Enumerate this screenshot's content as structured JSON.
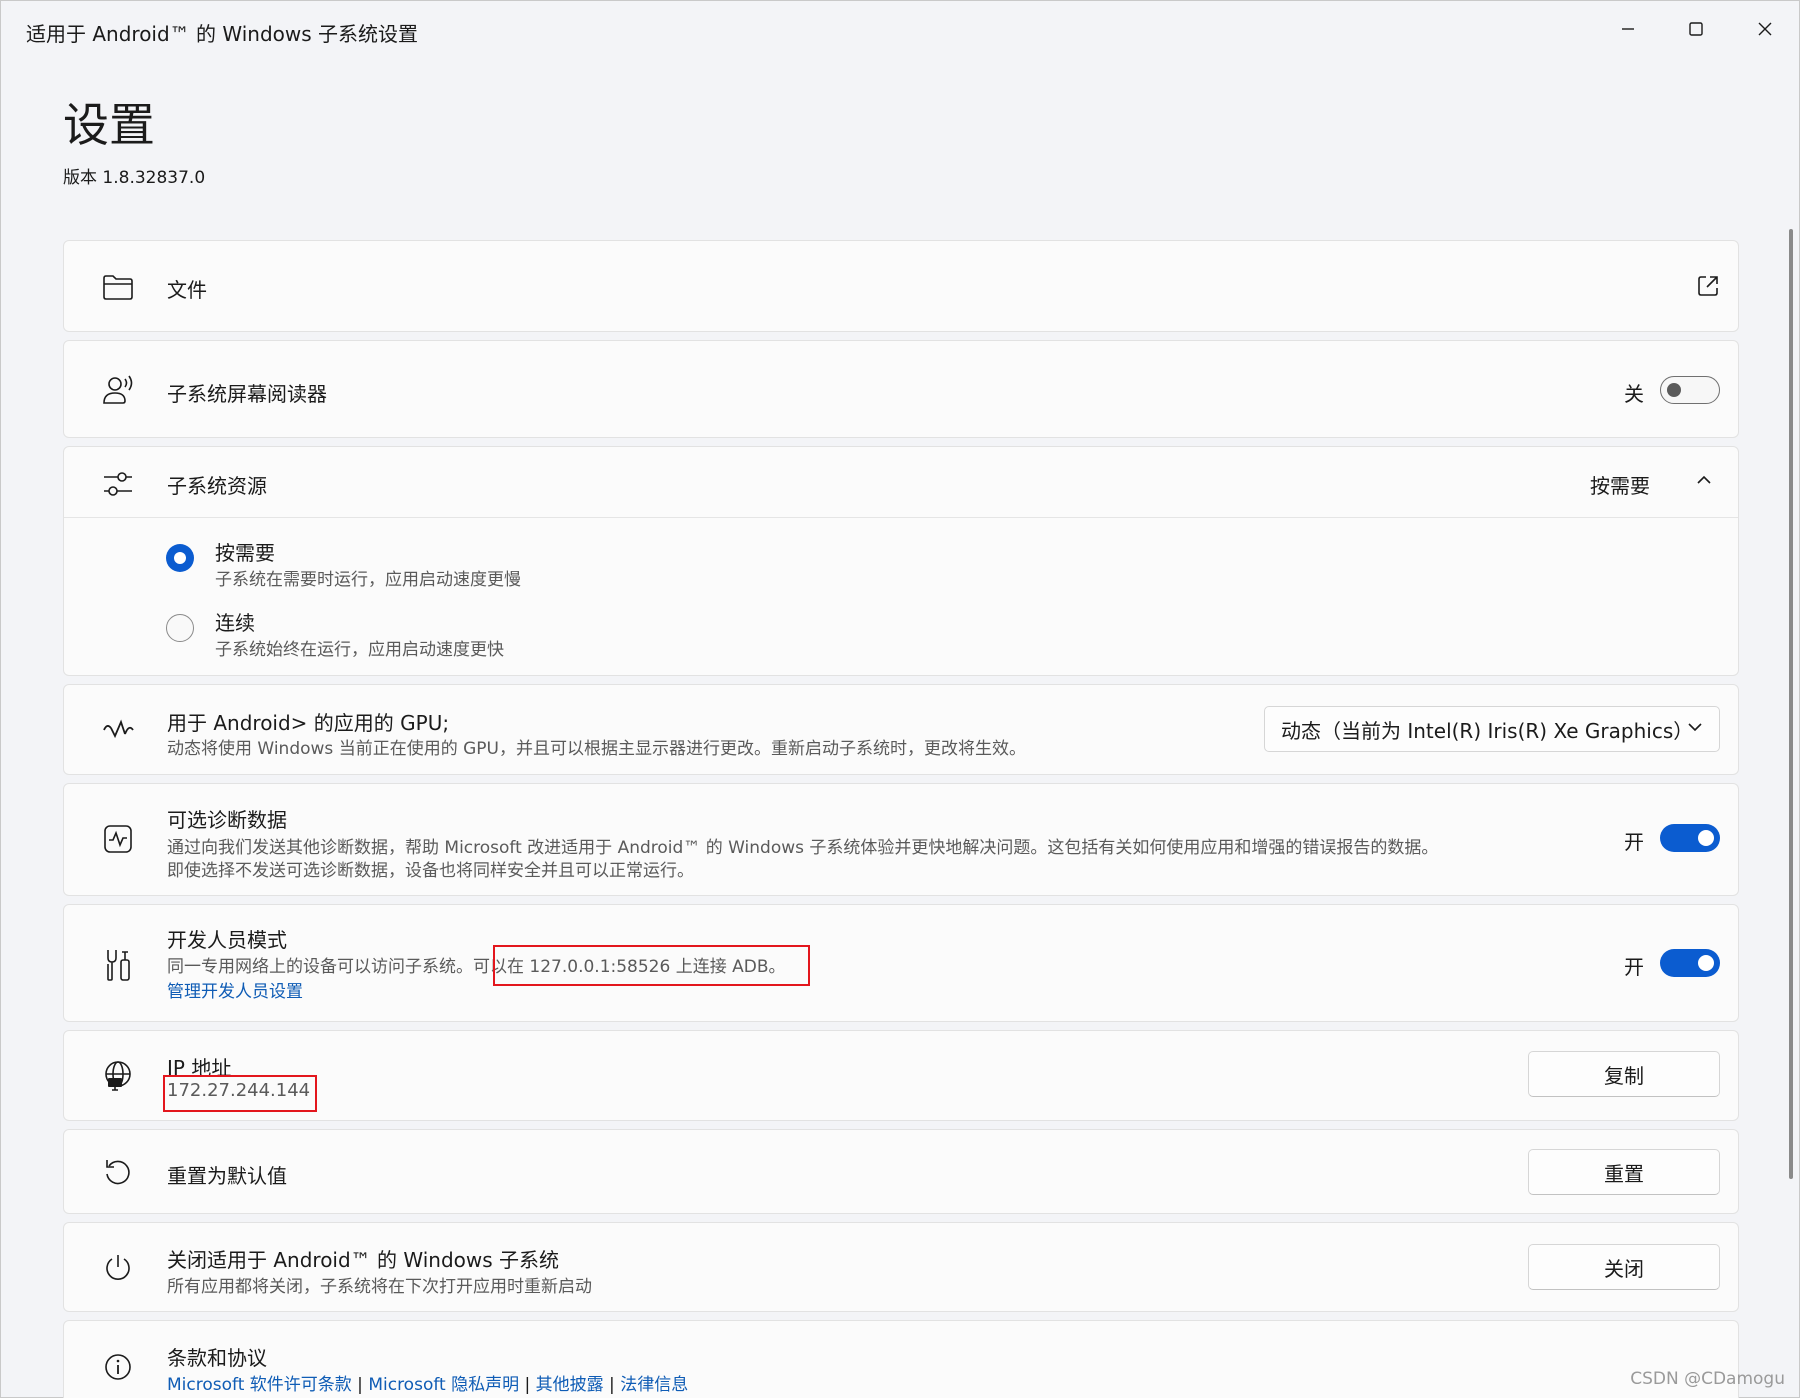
{
  "window": {
    "title": "适用于 Android™ 的 Windows 子系统设置",
    "minimize_icon": "minimize-icon",
    "maximize_icon": "maximize-icon",
    "close_icon": "close-icon"
  },
  "header": {
    "title": "设置",
    "version": "版本 1.8.32837.0"
  },
  "files": {
    "label": "文件",
    "icon": "folder-icon",
    "action_icon": "open-external-icon"
  },
  "screen_reader": {
    "label": "子系统屏幕阅读器",
    "state": "关",
    "enabled": false
  },
  "resources": {
    "label": "子系统资源",
    "selected": "按需要",
    "options": [
      {
        "label": "按需要",
        "desc": "子系统在需要时运行，应用启动速度更慢",
        "selected": true
      },
      {
        "label": "连续",
        "desc": "子系统始终在运行，应用启动速度更快",
        "selected": false
      }
    ]
  },
  "gpu": {
    "label": "用于 Android> 的应用的 GPU;",
    "desc": "动态将使用 Windows 当前正在使用的 GPU，并且可以根据主显示器进行更改。重新启动子系统时，更改将生效。",
    "selected_value": "动态（当前为 Intel(R) Iris(R) Xe Graphics）"
  },
  "diagnostics": {
    "label": "可选诊断数据",
    "desc_line1": "通过向我们发送其他诊断数据，帮助 Microsoft 改进适用于 Android™ 的 Windows 子系统体验并更快地解决问题。这包括有关如何使用应用和增强的错误报告的数据。",
    "desc_line2": "即使选择不发送可选诊断数据，设备也将同样安全并且可以正常运行。",
    "state": "开",
    "enabled": true
  },
  "developer": {
    "label": "开发人员模式",
    "desc": "同一专用网络上的设备可以访问子系统。",
    "adb_text": "可以在 127.0.0.1:58526 上连接 ADB。",
    "manage_link": "管理开发人员设置",
    "state": "开",
    "enabled": true
  },
  "ip": {
    "label": "IP 地址",
    "value": "172.27.244.144",
    "button": "复制"
  },
  "reset": {
    "label": "重置为默认值",
    "button": "重置"
  },
  "shutdown": {
    "label": "关闭适用于 Android™ 的 Windows 子系统",
    "desc": "所有应用都将关闭，子系统将在下次打开应用时重新启动",
    "button": "关闭"
  },
  "terms": {
    "label": "条款和协议",
    "links": [
      "Microsoft 软件许可条款",
      "Microsoft 隐私声明",
      "其他披露",
      "法律信息"
    ],
    "separator": " | "
  },
  "watermark": "CSDN @CDamogu",
  "colors": {
    "accent": "#0b5cd0",
    "link": "#0f5cb5",
    "highlight_box": "#e3161d"
  }
}
